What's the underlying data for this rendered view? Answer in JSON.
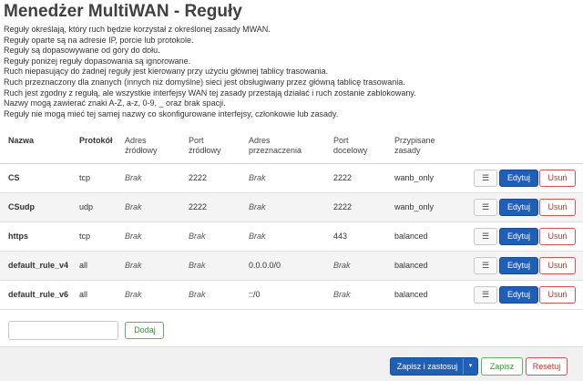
{
  "page": {
    "title": "Menedżer MultiWAN - Reguły",
    "description": [
      "Reguły określają, który ruch będzie korzystał z określonej zasady MWAN.",
      "Reguły oparte są na adresie IP, porcie lub protokole.",
      "Reguły są dopasowywane od góry do dołu.",
      "Reguły poniżej reguły dopasowania są ignorowane.",
      "Ruch niepasujący do żadnej reguły jest kierowany przy użyciu głównej tablicy trasowania.",
      "Ruch przeznaczony dla znanych (innych niż domyślne) sieci jest obsługiwany przez główną tablicę trasowania.",
      "Ruch jest zgodny z regułą, ale wszystkie interfejsy WAN tej zasady przestają działać i ruch zostanie zablokowany.",
      "Nazwy mogą zawierać znaki A-Z, a-z, 0-9, _ oraz brak spacji.",
      "Reguły nie mogą mieć tej samej nazwy co skonfigurowane interfejsy, członkowie lub zasady."
    ]
  },
  "table": {
    "headers": {
      "name": "Nazwa",
      "protocol": "Protokół",
      "src_addr_1": "Adres",
      "src_addr_2": "źródłowy",
      "src_port_1": "Port",
      "src_port_2": "źródłowy",
      "dest_addr_1": "Adres",
      "dest_addr_2": "przeznaczenia",
      "dest_port_1": "Port",
      "dest_port_2": "docelowy",
      "policy_1": "Przypisane",
      "policy_2": "zasady"
    },
    "rows": [
      {
        "name": "CS",
        "protocol": "tcp",
        "src_addr": "Brak",
        "src_port": "2222",
        "dest_addr": "Brak",
        "dest_port": "2222",
        "policy": "wanb_only"
      },
      {
        "name": "CSudp",
        "protocol": "udp",
        "src_addr": "Brak",
        "src_port": "2222",
        "dest_addr": "Brak",
        "dest_port": "2222",
        "policy": "wanb_only"
      },
      {
        "name": "https",
        "protocol": "tcp",
        "src_addr": "Brak",
        "src_port": "Brak",
        "dest_addr": "Brak",
        "dest_port": "443",
        "policy": "balanced"
      },
      {
        "name": "default_rule_v4",
        "protocol": "all",
        "src_addr": "Brak",
        "src_port": "Brak",
        "dest_addr": "0.0.0.0/0",
        "dest_port": "Brak",
        "policy": "balanced"
      },
      {
        "name": "default_rule_v6",
        "protocol": "all",
        "src_addr": "Brak",
        "src_port": "Brak",
        "dest_addr": "::/0",
        "dest_port": "Brak",
        "policy": "balanced"
      }
    ],
    "actions": {
      "drag_glyph": "☰",
      "edit_label": "Edytuj",
      "delete_label": "Usuń"
    }
  },
  "add": {
    "input_value": "",
    "button_label": "Dodaj"
  },
  "footer": {
    "save_apply_label": "Zapisz i zastosuj",
    "caret_glyph": "▾",
    "save_label": "Zapisz",
    "reset_label": "Resetuj"
  }
}
